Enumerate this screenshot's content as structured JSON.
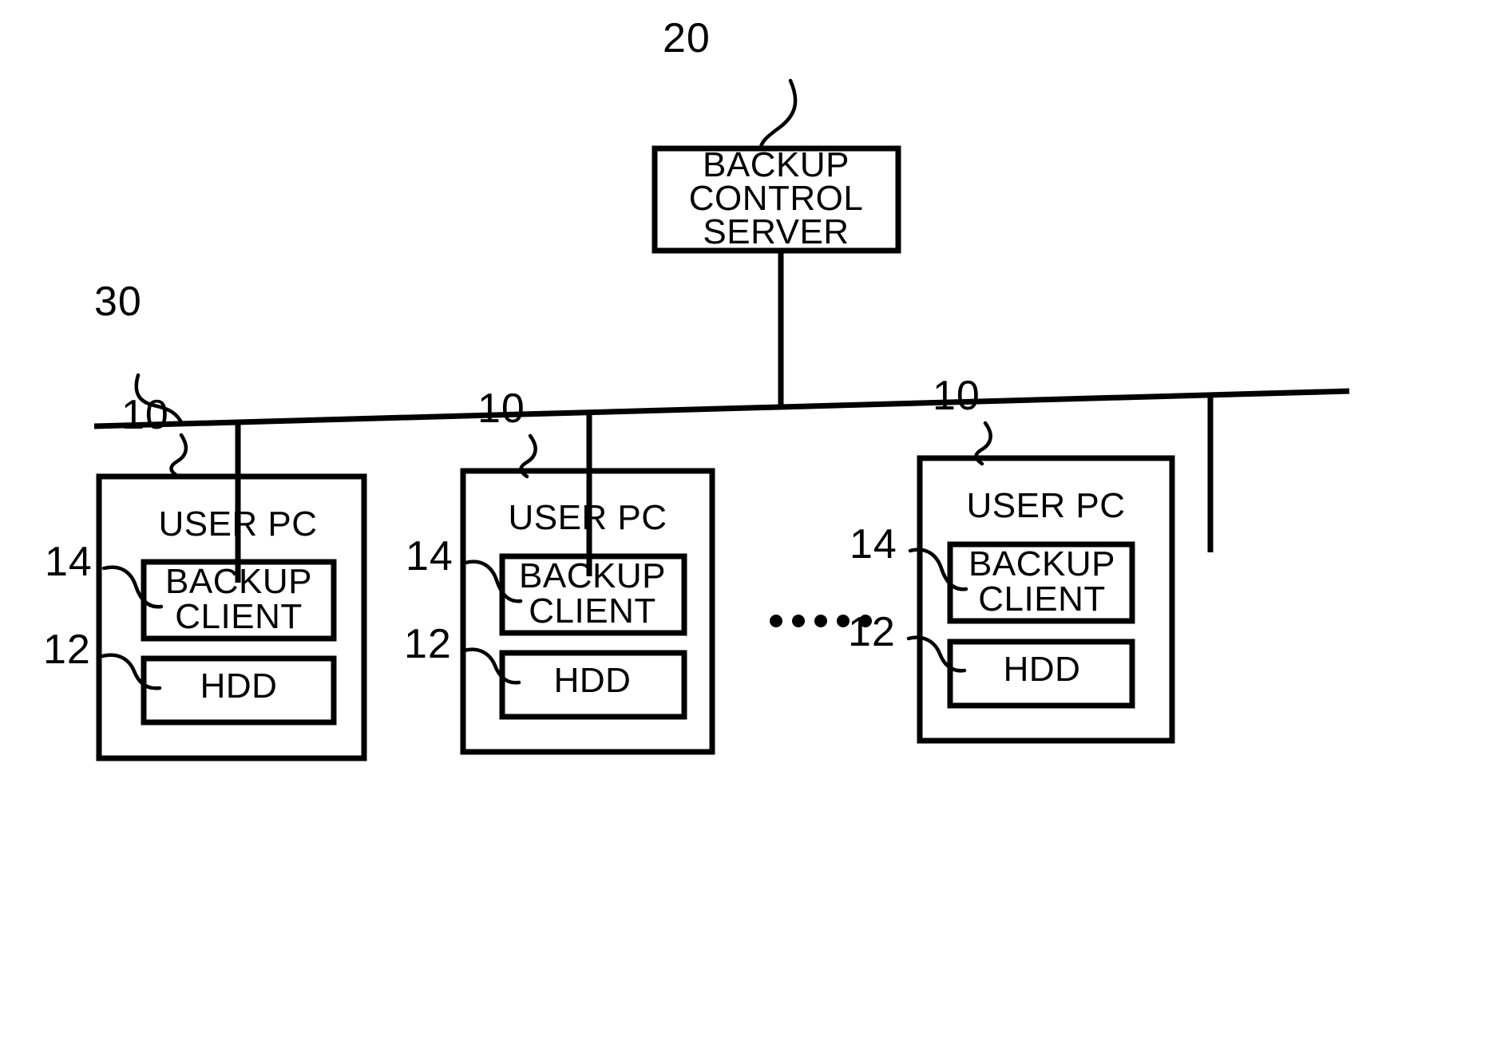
{
  "figure": {
    "type": "patent-block-diagram",
    "background_color": "#ffffff",
    "line_color": "#000000"
  },
  "server": {
    "ref": "20",
    "line1": "BACKUP",
    "line2": "CONTROL",
    "line3": "SERVER"
  },
  "network": {
    "ref": "30"
  },
  "ellipsis": {
    "glyph": "•",
    "count": 5
  },
  "clients": [
    {
      "pc_ref": "10",
      "pc_label": "USER PC",
      "client_ref": "14",
      "client_line1": "BACKUP",
      "client_line2": "CLIENT",
      "hdd_ref": "12",
      "hdd_label": "HDD"
    },
    {
      "pc_ref": "10",
      "pc_label": "USER PC",
      "client_ref": "14",
      "client_line1": "BACKUP",
      "client_line2": "CLIENT",
      "hdd_ref": "12",
      "hdd_label": "HDD"
    },
    {
      "pc_ref": "10",
      "pc_label": "USER PC",
      "client_ref": "14",
      "client_line1": "BACKUP",
      "client_line2": "CLIENT",
      "hdd_ref": "12",
      "hdd_label": "HDD"
    }
  ]
}
